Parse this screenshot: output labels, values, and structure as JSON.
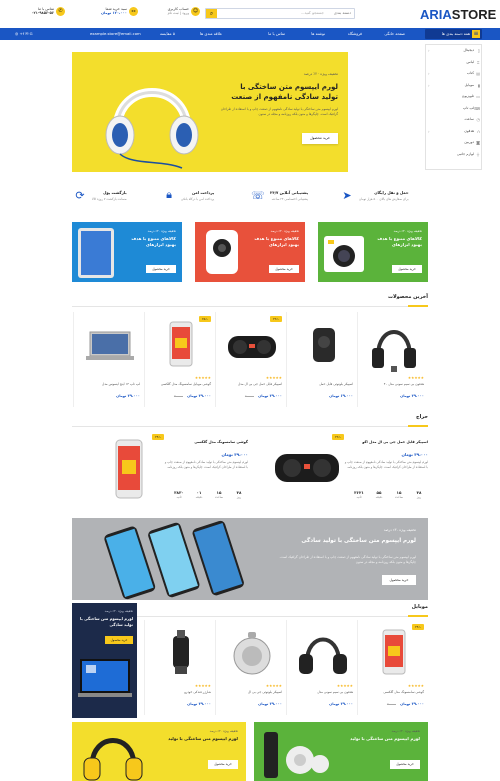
{
  "header": {
    "logo_main": "ARIA",
    "logo_accent": "STORE",
    "search_placeholder": "جستجو کنید...",
    "search_category": "دسته بندی",
    "account_title": "حساب کاربری",
    "account_sub": "ورود | ثبت نام",
    "cart_title": "سبد خرید شما",
    "cart_price": "۱۲۰،۰۰۰ تومان",
    "contact_title": "تماس با ما",
    "contact_phone": "۰۲۱-۹۸۵۶-۵۶"
  },
  "nav": {
    "categories": "همه دسته بندی ها",
    "items": [
      "صفحه خانگی",
      "فروشگاه",
      "نوشته ها",
      "تماس با ما"
    ],
    "email": "example.store@email.com",
    "compare": "۵ مقایسه",
    "wishlist": "علاقه مندی ها"
  },
  "sidebar": {
    "items": [
      {
        "label": "دیجیتال",
        "icon": "phone-icon"
      },
      {
        "label": "لباس",
        "icon": "shirt-icon"
      },
      {
        "label": "کتاب",
        "icon": "book-icon"
      },
      {
        "label": "موبایل",
        "icon": "mobile-icon"
      },
      {
        "label": "تلویزیون",
        "icon": "tv-icon"
      },
      {
        "label": "لپ تاپ",
        "icon": "laptop-icon"
      },
      {
        "label": "ساعت",
        "icon": "watch-icon"
      },
      {
        "label": "هدفون",
        "icon": "headphone-icon"
      },
      {
        "label": "دوربین",
        "icon": "camera-icon"
      },
      {
        "label": "لوازم جانبی",
        "icon": "plug-icon"
      }
    ]
  },
  "hero": {
    "tag": "تخفیف ویژه ۲۰٪ درصد",
    "title": "لورم ایپسوم متن ساختگی با تولید سادگی نامفهوم از صنعت",
    "desc": "لورم ایپسوم متن ساختگی با تولید سادگی نامفهوم از صنعت چاپ و با استفاده از طراحان گرافیک است. چاپگرها و متون بلکه روزنامه و مجله در ستون",
    "button": "خرید محصول"
  },
  "features": [
    {
      "title": "حمل و نقل رایگان",
      "desc": "برای سفارش های بالای ۵۰۰ هزار تومان",
      "icon": "send-icon"
    },
    {
      "title": "پشتیبانی آنلاین ۲۴/۷",
      "desc": "پشتیبانی اختصاصی ۲۴ ساعته",
      "icon": "headset-icon"
    },
    {
      "title": "پرداخت امن",
      "desc": "پرداخت امن با درگاه بانکی",
      "icon": "lock-icon"
    },
    {
      "title": "بازگشت پول",
      "desc": "ضمانت بازگشت ۷ روزه کالا",
      "icon": "refresh-icon"
    }
  ],
  "banners": [
    {
      "tag": "تخفیف ویژه ۳۰٪ درصد",
      "title": "کالاهای متنوع با هدف بهبود ابزارهای",
      "button": "خرید محصول",
      "color": "#5bb33b"
    },
    {
      "tag": "تخفیف ویژه ۳۰٪ درصد",
      "title": "کالاهای متنوع با هدف بهبود ابزارهای",
      "button": "خرید محصول",
      "color": "#e8513b"
    },
    {
      "tag": "تخفیف ویژه ۳۰٪ درصد",
      "title": "کالاهای متنوع با هدف بهبود ابزارهای",
      "button": "خرید محصول",
      "color": "#1e8ad6"
    }
  ],
  "latest": {
    "title": "آخرین محصولات",
    "products": [
      {
        "name": "هدفون بی سیم سونی مدل ۴۰",
        "price": "۳۹،۰۰۰ تومان",
        "old": "",
        "badge": "",
        "rating": "★★★★★"
      },
      {
        "name": "اسپیکر بلوتوثی قابل حمل",
        "price": "۶۹،۰۰۰ تومان",
        "old": "",
        "badge": "",
        "rating": ""
      },
      {
        "name": "اسپیکر قابل حمل جی بی ال مدل",
        "price": "۳۹،۰۰۰ تومان",
        "old": "۶۰،۰۰۰",
        "badge": "-۲۲٪",
        "rating": "★★★★★"
      },
      {
        "name": "گوشی موبایل سامسونگ مدل گلکسی",
        "price": "۳۹،۰۰۰ تومان",
        "old": "۷۰،۰۰۰",
        "badge": "-۲۵٪",
        "rating": "★★★★★"
      },
      {
        "name": "لپ تاپ ۱۴ اینچ ایسوس مدل",
        "price": "۳۹،۰۰۰ تومان",
        "old": "",
        "badge": "",
        "rating": ""
      }
    ]
  },
  "deals": {
    "title": "حراج",
    "items": [
      {
        "name": "اسپیکر قابل حمل جی بی ال مدل اکو",
        "price": "۳۹،۰۰۰ تومان",
        "old": "۶۰،۰۰۰ تومان",
        "badge": "-۲۲٪",
        "desc": "لورم ایپسوم متن ساختگی با تولید سادگی نامفهوم از صنعت چاپ و با استفاده از طراحان گرافیک است. چاپگرها و متون بلکه روزنامه",
        "countdown": [
          {
            "n": "۴۸",
            "l": "روز"
          },
          {
            "n": "۱۵",
            "l": "ساعت"
          },
          {
            "n": "۵۵",
            "l": "دقیقه"
          },
          {
            "n": "۳۶۲۱",
            "l": "ثانیه"
          }
        ]
      },
      {
        "name": "گوشی سامسونگ مدل گلکسی",
        "price": "۳۹،۰۰۰ تومان",
        "old": "۷۰،۰۰۰ تومان",
        "badge": "-۲۴٪",
        "desc": "لورم ایپسوم متن ساختگی با تولید سادگی نامفهوم از صنعت چاپ و با استفاده از طراحان گرافیک است. چاپگرها و متون بلکه روزنامه",
        "countdown": [
          {
            "n": "۴۸",
            "l": "روز"
          },
          {
            "n": "۱۵",
            "l": "ساعت"
          },
          {
            "n": "۰۱",
            "l": "دقیقه"
          },
          {
            "n": "۳۸۳۰",
            "l": "ثانیه"
          }
        ]
      }
    ]
  },
  "wide_banner": {
    "tag": "تخفیف ویژه ۳۰٪ درصد",
    "title": "لورم ایپسوم متن ساختگی با تولید سادگی",
    "desc": "لورم ایپسوم متن ساختگی با تولید سادگی نامفهوم از صنعت چاپ و با استفاده از طراحان گرافیک است. چاپگرها و متون بلکه روزنامه و مجله در ستون",
    "button": "خرید محصول"
  },
  "mobile": {
    "title": "موبایل",
    "promo": {
      "tag": "تخفیف ویژه ۳۰٪ درصد",
      "title": "لورم ایپسوم متن ساختگی با تولید سادگی",
      "button": "خرید محصول"
    },
    "products": [
      {
        "name": "گوشی سامسونگ مدل گلکسی",
        "price": "۳۹،۰۰۰ تومان",
        "old": "۷۰،۰۰۰",
        "badge": "-۲۴٪",
        "rating": "★★★★★"
      },
      {
        "name": "هدفون بی سیم سونی مدل",
        "price": "۳۹،۰۰۰ تومان",
        "old": "",
        "badge": "",
        "rating": "★★★★★"
      },
      {
        "name": "اسپیکر بلوتوثی جی بی ال",
        "price": "۳۹،۰۰۰ تومان",
        "old": "",
        "badge": "",
        "rating": "★★★★★"
      },
      {
        "name": "شارژر فندکی خودرو",
        "price": "۳۹،۰۰۰ تومان",
        "old": "",
        "badge": "",
        "rating": "★★★★★"
      }
    ]
  },
  "bottom_banners": [
    {
      "tag": "تخفیف ویژه ۳۰٪ درصد",
      "title": "لورم ایپسوم متن ساختگی با تولید",
      "button": "خرید محصول",
      "color": "#5bb33b"
    },
    {
      "tag": "تخفیف ویژه ۳۰٪ درصد",
      "title": "لورم ایپسوم متن ساختگی با تولید",
      "button": "خرید محصول",
      "color": "#f3de2c"
    }
  ],
  "colors": {
    "primary": "#1a56c4",
    "accent": "#f7c81b",
    "green": "#5bb33b",
    "red": "#e8513b",
    "blue": "#1e8ad6"
  }
}
